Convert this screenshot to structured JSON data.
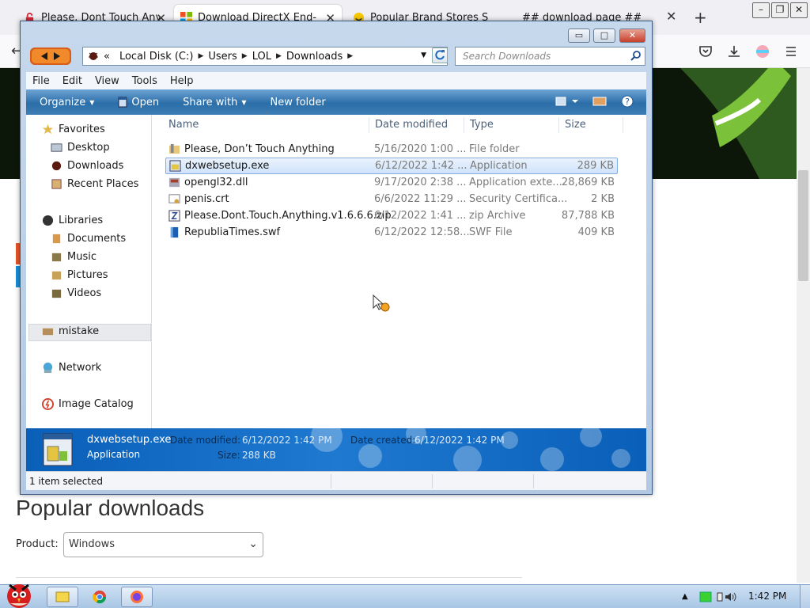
{
  "browser": {
    "tabs": [
      {
        "title": "Please, Dont Touch Anythi..."
      },
      {
        "title": "Download DirectX End-Use..."
      },
      {
        "title": "Popular Brand Stores Sale P..."
      },
      {
        "title": "## download page ##"
      }
    ],
    "tab_close": "✕",
    "new_tab": "+",
    "back": "←"
  },
  "page": {
    "popular_title": "Popular downloads",
    "product_label": "Product:",
    "product_value": "Windows"
  },
  "explorer": {
    "address": {
      "overflow": "«",
      "segments": [
        "Local Disk (C:)",
        "Users",
        "LOL",
        "Downloads"
      ],
      "separator": "▶"
    },
    "search_placeholder": "Search Downloads",
    "menu": [
      "File",
      "Edit",
      "View",
      "Tools",
      "Help"
    ],
    "toolbar": {
      "organize": "Organize",
      "open": "Open",
      "share": "Share with",
      "new_folder": "New folder"
    },
    "nav": {
      "favorites": "Favorites",
      "desktop": "Desktop",
      "downloads": "Downloads",
      "recent": "Recent Places",
      "libraries": "Libraries",
      "documents": "Documents",
      "music": "Music",
      "pictures": "Pictures",
      "videos": "Videos",
      "mistake": "mistake",
      "network": "Network",
      "image_catalog": "Image Catalog"
    },
    "columns": {
      "name": "Name",
      "date": "Date modified",
      "type": "Type",
      "size": "Size"
    },
    "files": [
      {
        "name": "Please, Don’t Touch Anything",
        "date": "5/16/2020 1:00 ...",
        "type": "File folder",
        "size": ""
      },
      {
        "name": "dxwebsetup.exe",
        "date": "6/12/2022 1:42 ...",
        "type": "Application",
        "size": "289 KB"
      },
      {
        "name": "opengl32.dll",
        "date": "9/17/2020 2:38 ...",
        "type": "Application exte...",
        "size": "28,869 KB"
      },
      {
        "name": "penis.crt",
        "date": "6/6/2022 11:29 ...",
        "type": "Security Certifica...",
        "size": "2 KB"
      },
      {
        "name": "Please.Dont.Touch.Anything.v1.6.6.6.zip",
        "date": "6/12/2022 1:41 ...",
        "type": "zip Archive",
        "size": "87,788 KB"
      },
      {
        "name": "RepubliaTimes.swf",
        "date": "6/12/2022 12:58...",
        "type": "SWF File",
        "size": "409 KB"
      }
    ],
    "details": {
      "filename": "dxwebsetup.exe",
      "filetype": "Application",
      "modified_label": "Date modified:",
      "modified_value": "6/12/2022 1:42 PM",
      "created_label": "Date created:",
      "created_value": "6/12/2022 1:42 PM",
      "size_label": "Size:",
      "size_value": "288 KB"
    },
    "status": "1 item selected"
  },
  "taskbar": {
    "clock": "1:42 PM"
  },
  "colors": {
    "toolbar_blue": "#2b6ea8",
    "details_blue": "#1f79d0",
    "selection": "#cfe3fb",
    "close_red": "#c6402a"
  }
}
